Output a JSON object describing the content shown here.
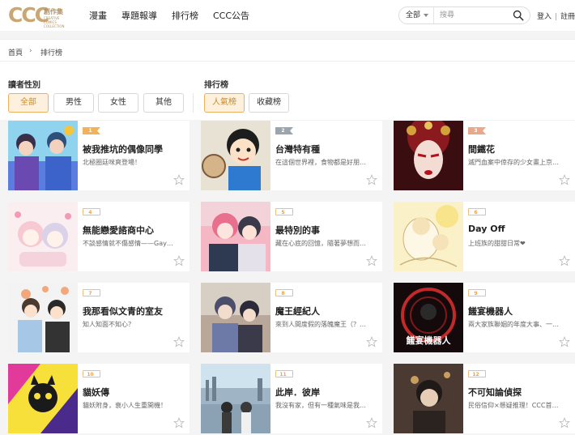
{
  "header": {
    "logo_text": "CCC",
    "logo_sub": "創作集",
    "logo_small": "CREATIVE COMICS COLLECTION",
    "nav": [
      "漫畫",
      "專題報導",
      "排行榜",
      "CCC公告"
    ],
    "search": {
      "scope": "全部",
      "placeholder": "搜尋"
    },
    "login": "登入",
    "register": "註冊"
  },
  "breadcrumb": {
    "home": "首頁",
    "current": "排行榜"
  },
  "filters": {
    "gender_label": "讀者性別",
    "gender_options": [
      "全部",
      "男性",
      "女性",
      "其他"
    ],
    "rank_label": "排行榜",
    "rank_options": [
      "人氣榜",
      "收藏榜"
    ]
  },
  "rankings": [
    {
      "rank": "1",
      "title": "被我推坑的偶像同學",
      "desc": "北極圈廷咪爽登場！"
    },
    {
      "rank": "2",
      "title": "台灣特有種",
      "desc": "在這個世界裡，食物都是好朋友！"
    },
    {
      "rank": "3",
      "title": "間鐵花",
      "desc": "滅門血案中倖存的少女畫上京劇..."
    },
    {
      "rank": "4",
      "title": "無能戀愛諮商中心",
      "desc": "不談感情就不傷感情——Gay與..."
    },
    {
      "rank": "5",
      "title": "最特別的事",
      "desc": "藏在心底的回憶，隨著夢想而漸..."
    },
    {
      "rank": "6",
      "title": "Day Off",
      "desc": "上班族的甜甜日常❤"
    },
    {
      "rank": "7",
      "title": "我那看似文青的室友",
      "desc": "知人知面不知心？"
    },
    {
      "rank": "8",
      "title": "魔王經紀人",
      "desc": "來到人間度假的落魄魔王（？）..."
    },
    {
      "rank": "9",
      "title": "饈宴機器人",
      "desc": "兩大家族聯姻的年度大事、一場..."
    },
    {
      "rank": "10",
      "title": "貓妖傳",
      "desc": "貓妖附身，衰小人生重開機！"
    },
    {
      "rank": "11",
      "title": "此岸．彼岸",
      "desc": "我沒有家，但有一種氣味是我唯..."
    },
    {
      "rank": "12",
      "title": "不可知論偵探",
      "desc": "民俗信仰×懸疑推理！CCC首位..."
    }
  ],
  "thumb_overlay_text": "饈宴機器人",
  "colors": {
    "accent": "#e9b05f",
    "accent_text": "#c98a2c",
    "logo": "#c9a673"
  }
}
